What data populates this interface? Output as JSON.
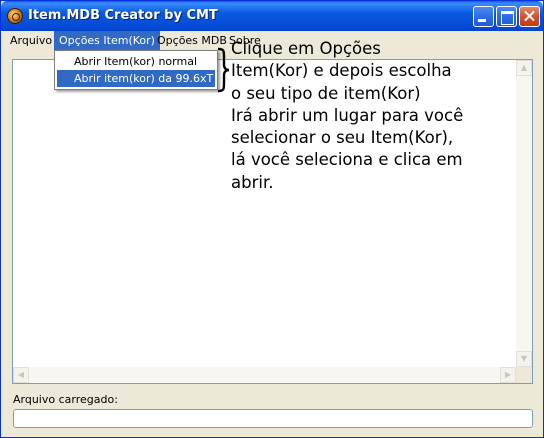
{
  "window": {
    "title": "Item.MDB Creator by CMT",
    "app_icon": "app-logo-icon",
    "controls": [
      "minimize-icon",
      "maximize-icon",
      "close-icon"
    ]
  },
  "menubar": {
    "items": [
      {
        "label": "Arquivo"
      },
      {
        "label": "Opções Item(Kor)"
      },
      {
        "label": "Opções MDB"
      },
      {
        "label": "Sobre"
      }
    ]
  },
  "dropdown": {
    "items": [
      {
        "label": "Abrir Item(kor) normal"
      },
      {
        "label": "Abrir item(kor) da 99.6xT"
      }
    ]
  },
  "annotation": {
    "text": "Clique em  Opções\nItem(Kor) e depois escolha\no seu tipo de item(Kor)\nIrá abrir um lugar para você\nselecionar o seu Item(Kor),\nlá você seleciona e clica em\nabrir."
  },
  "status": {
    "label": "Arquivo carregado:",
    "value": ""
  },
  "colors": {
    "titlebar": "#0a5ae0",
    "menu_highlight": "#316ac5",
    "window_bg": "#ece9d8"
  }
}
